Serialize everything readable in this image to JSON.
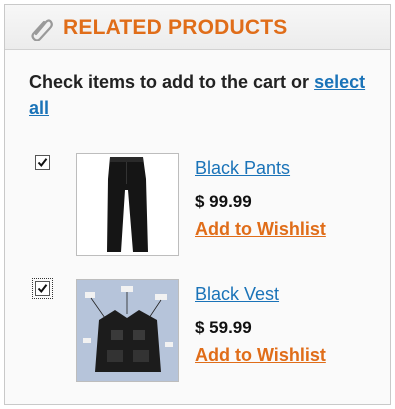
{
  "block": {
    "title": "RELATED PRODUCTS",
    "intro_text": "Check items to add to the cart or",
    "select_all_label": "select all"
  },
  "products": [
    {
      "name": "Black Pants",
      "price": "$ 99.99",
      "wishlist_label": "Add to Wishlist",
      "checked": true
    },
    {
      "name": "Black Vest",
      "price": "$ 59.99",
      "wishlist_label": "Add to Wishlist",
      "checked": true
    }
  ],
  "colors": {
    "accent": "#e06d19",
    "link": "#1a73b8"
  },
  "icons": {
    "header": "paperclip-icon",
    "checkbox": "checkmark-icon"
  }
}
